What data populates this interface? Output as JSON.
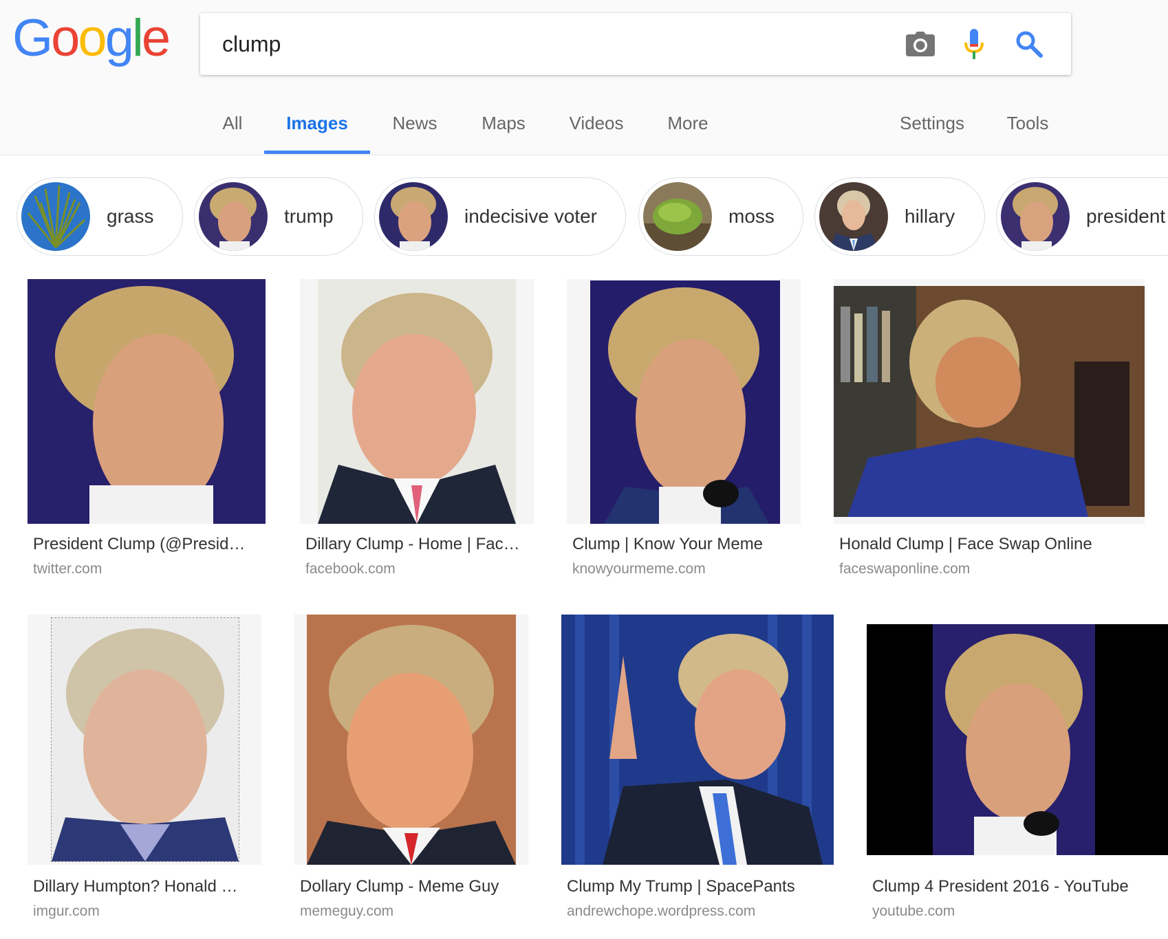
{
  "logo": {
    "letters": [
      "G",
      "o",
      "o",
      "g",
      "l",
      "e"
    ],
    "colors": [
      "#4285f4",
      "#ea4335",
      "#fbbc05",
      "#4285f4",
      "#34a853",
      "#ea4335"
    ]
  },
  "search": {
    "query": "clump",
    "icons": [
      "camera-icon",
      "microphone-icon",
      "search-icon"
    ]
  },
  "tabs": [
    {
      "label": "All",
      "active": false
    },
    {
      "label": "Images",
      "active": true
    },
    {
      "label": "News",
      "active": false
    },
    {
      "label": "Maps",
      "active": false
    },
    {
      "label": "Videos",
      "active": false
    },
    {
      "label": "More",
      "active": false
    },
    {
      "label": "Settings",
      "active": false
    },
    {
      "label": "Tools",
      "active": false
    }
  ],
  "chips": [
    {
      "label": "grass"
    },
    {
      "label": "trump"
    },
    {
      "label": "indecisive voter"
    },
    {
      "label": "moss"
    },
    {
      "label": "hillary"
    },
    {
      "label": "president"
    }
  ],
  "results": [
    {
      "title": "President Clump (@Presid…",
      "domain": "twitter.com"
    },
    {
      "title": "Dillary Clump - Home | Fac…",
      "domain": "facebook.com"
    },
    {
      "title": "Clump | Know Your Meme",
      "domain": "knowyourmeme.com"
    },
    {
      "title": "Honald Clump | Face Swap Online",
      "domain": "faceswaponline.com"
    },
    {
      "title": "Dillary Humpton? Honald …",
      "domain": "imgur.com"
    },
    {
      "title": "Dollary Clump - Meme Guy",
      "domain": "memeguy.com"
    },
    {
      "title": "Clump My Trump | SpacePants",
      "domain": "andrewchope.wordpress.com"
    },
    {
      "title": "Clump 4 President 2016 - YouTube",
      "domain": "youtube.com"
    }
  ],
  "colors": {
    "accent": "#4285f4",
    "active_tab": "#1a73e8",
    "muted": "#8a8a8a"
  }
}
